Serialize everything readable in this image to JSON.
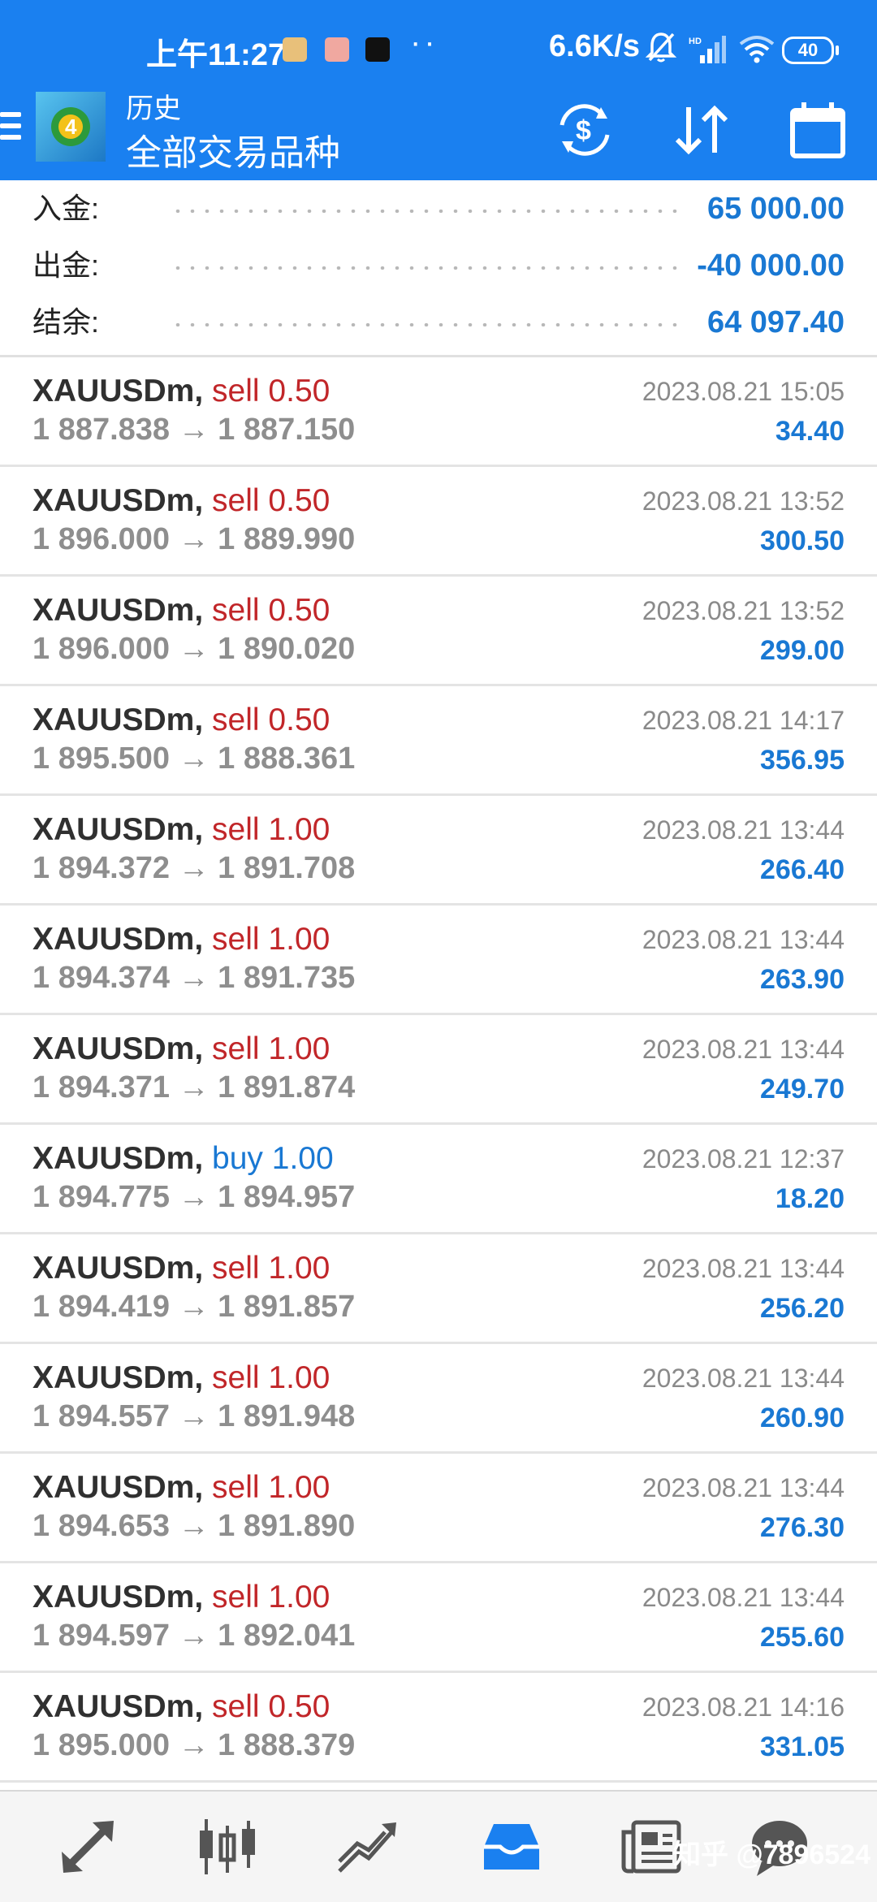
{
  "status_bar": {
    "time": "上午11:27",
    "speed": "6.6K/s",
    "battery": "40"
  },
  "header": {
    "subtitle": "历史",
    "title": "全部交易品种",
    "accent": "#1a80f0"
  },
  "summary": [
    {
      "label": "入金:",
      "value": "65 000.00"
    },
    {
      "label": "出金:",
      "value": "-40 000.00"
    },
    {
      "label": "结余:",
      "value": "64 097.40"
    }
  ],
  "trades": [
    {
      "symbol": "XAUUSDm,",
      "side": "sell",
      "volume": "0.50",
      "prices": "1 887.838 → 1 887.150",
      "time": "2023.08.21 15:05",
      "profit": "34.40"
    },
    {
      "symbol": "XAUUSDm,",
      "side": "sell",
      "volume": "0.50",
      "prices": "1 896.000 → 1 889.990",
      "time": "2023.08.21 13:52",
      "profit": "300.50"
    },
    {
      "symbol": "XAUUSDm,",
      "side": "sell",
      "volume": "0.50",
      "prices": "1 896.000 → 1 890.020",
      "time": "2023.08.21 13:52",
      "profit": "299.00"
    },
    {
      "symbol": "XAUUSDm,",
      "side": "sell",
      "volume": "0.50",
      "prices": "1 895.500 → 1 888.361",
      "time": "2023.08.21 14:17",
      "profit": "356.95"
    },
    {
      "symbol": "XAUUSDm,",
      "side": "sell",
      "volume": "1.00",
      "prices": "1 894.372 → 1 891.708",
      "time": "2023.08.21 13:44",
      "profit": "266.40"
    },
    {
      "symbol": "XAUUSDm,",
      "side": "sell",
      "volume": "1.00",
      "prices": "1 894.374 → 1 891.735",
      "time": "2023.08.21 13:44",
      "profit": "263.90"
    },
    {
      "symbol": "XAUUSDm,",
      "side": "sell",
      "volume": "1.00",
      "prices": "1 894.371 → 1 891.874",
      "time": "2023.08.21 13:44",
      "profit": "249.70"
    },
    {
      "symbol": "XAUUSDm,",
      "side": "buy",
      "volume": "1.00",
      "prices": "1 894.775 → 1 894.957",
      "time": "2023.08.21 12:37",
      "profit": "18.20"
    },
    {
      "symbol": "XAUUSDm,",
      "side": "sell",
      "volume": "1.00",
      "prices": "1 894.419 → 1 891.857",
      "time": "2023.08.21 13:44",
      "profit": "256.20"
    },
    {
      "symbol": "XAUUSDm,",
      "side": "sell",
      "volume": "1.00",
      "prices": "1 894.557 → 1 891.948",
      "time": "2023.08.21 13:44",
      "profit": "260.90"
    },
    {
      "symbol": "XAUUSDm,",
      "side": "sell",
      "volume": "1.00",
      "prices": "1 894.653 → 1 891.890",
      "time": "2023.08.21 13:44",
      "profit": "276.30"
    },
    {
      "symbol": "XAUUSDm,",
      "side": "sell",
      "volume": "1.00",
      "prices": "1 894.597 → 1 892.041",
      "time": "2023.08.21 13:44",
      "profit": "255.60"
    },
    {
      "symbol": "XAUUSDm,",
      "side": "sell",
      "volume": "0.50",
      "prices": "1 895.000 → 1 888.379",
      "time": "2023.08.21 14:16",
      "profit": "331.05"
    }
  ],
  "colors": {
    "sell": "#c12629",
    "buy": "#1978d3",
    "profit": "#1978d3",
    "active_tab": "#1a80f0"
  },
  "bottom_nav": [
    {
      "icon": "trade-arrows-icon"
    },
    {
      "icon": "candlestick-chart-icon"
    },
    {
      "icon": "line-chart-icon"
    },
    {
      "icon": "inbox-history-icon",
      "active": true
    },
    {
      "icon": "news-icon"
    },
    {
      "icon": "chat-icon"
    }
  ],
  "watermark": "知乎 @7896524"
}
